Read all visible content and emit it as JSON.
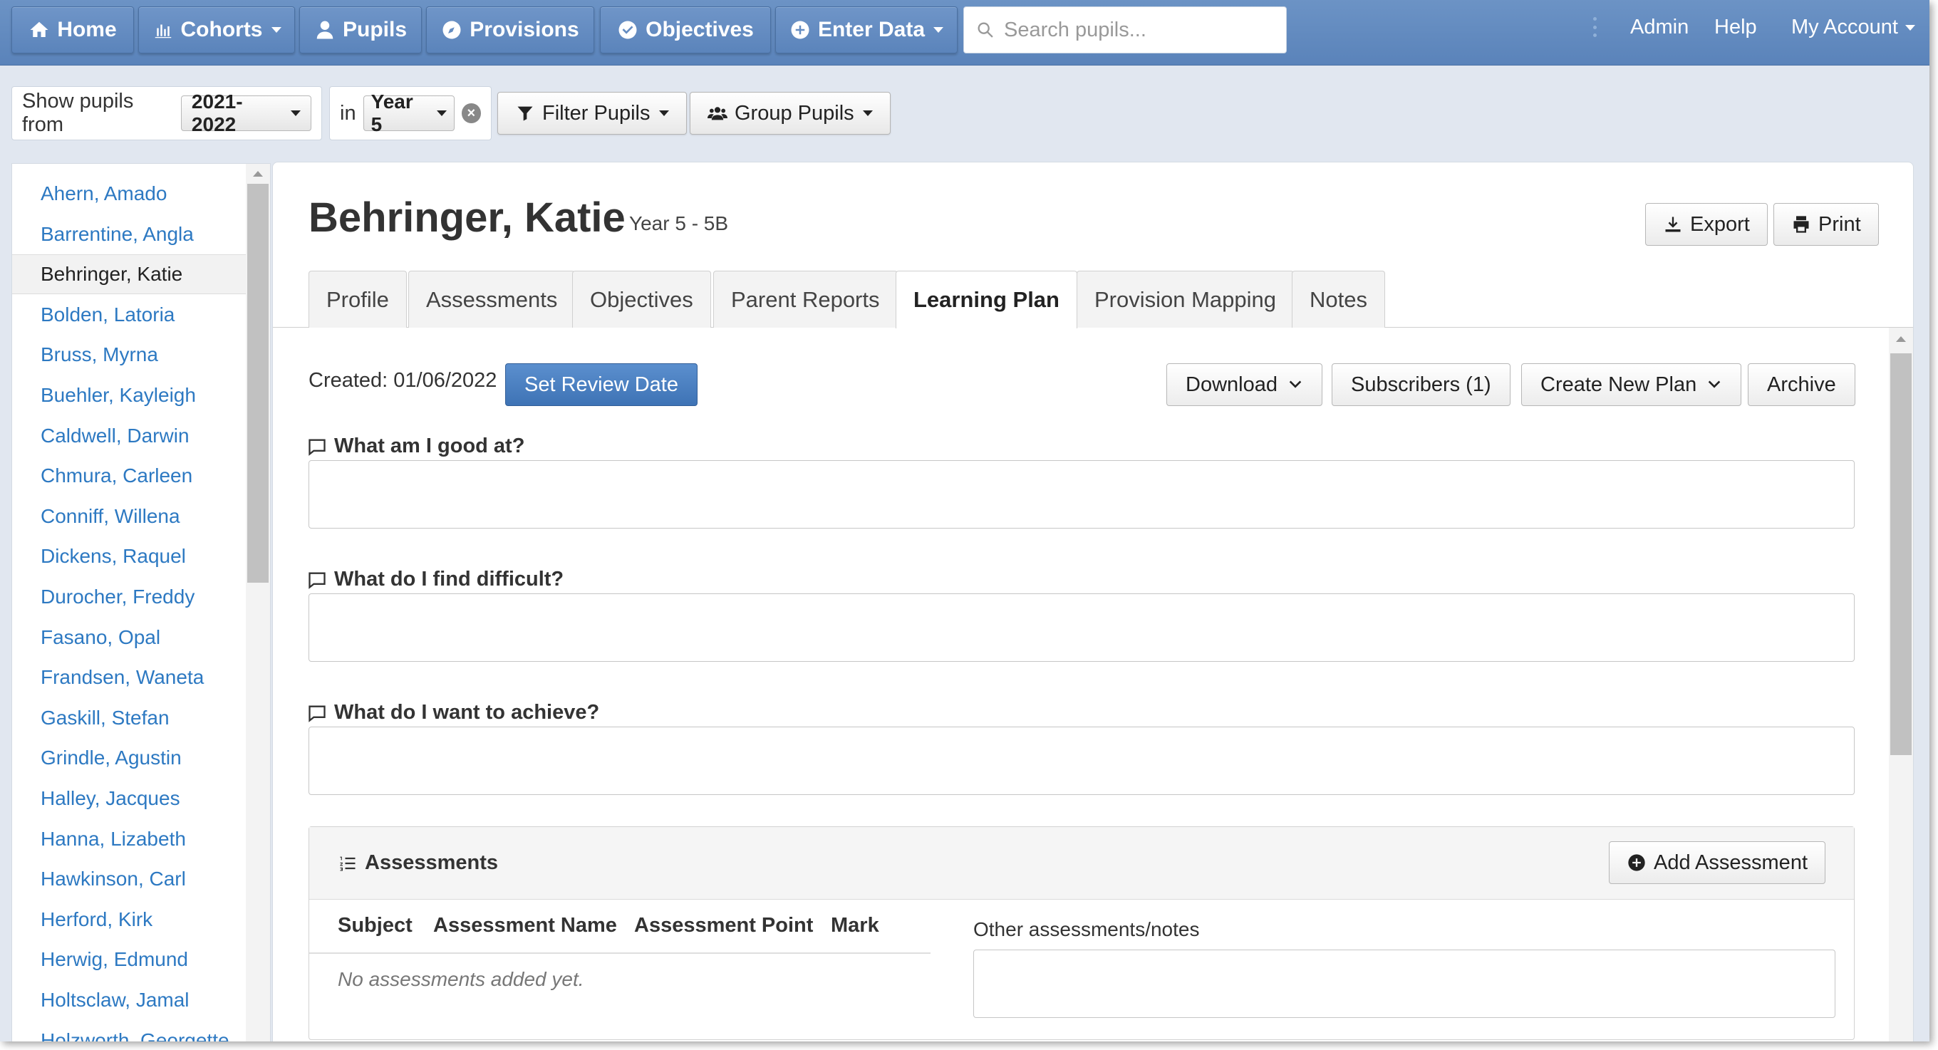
{
  "nav": {
    "home": "Home",
    "cohorts": "Cohorts",
    "pupils": "Pupils",
    "provisions": "Provisions",
    "objectives": "Objectives",
    "enter_data": "Enter Data",
    "search_placeholder": "Search pupils...",
    "admin": "Admin",
    "help": "Help",
    "my_account": "My Account"
  },
  "filters": {
    "show_pupils_from": "Show pupils from",
    "year_range": "2021-2022",
    "in": "in",
    "year_group": "Year 5",
    "filter_pupils": "Filter Pupils",
    "group_pupils": "Group Pupils"
  },
  "sidebar": {
    "pupils": [
      "Ahern, Amado",
      "Barrentine, Angla",
      "Behringer, Katie",
      "Bolden, Latoria",
      "Bruss, Myrna",
      "Buehler, Kayleigh",
      "Caldwell, Darwin",
      "Chmura, Carleen",
      "Conniff, Willena",
      "Dickens, Raquel",
      "Durocher, Freddy",
      "Fasano, Opal",
      "Frandsen, Waneta",
      "Gaskill, Stefan",
      "Grindle, Agustin",
      "Halley, Jacques",
      "Hanna, Lizabeth",
      "Hawkinson, Carl",
      "Herford, Kirk",
      "Herwig, Edmund",
      "Holtsclaw, Jamal",
      "Holzworth, Georgette"
    ],
    "active_pupil": "Behringer, Katie"
  },
  "pupil": {
    "name": "Behringer, Katie",
    "class": "Year 5 - 5B",
    "export": "Export",
    "print": "Print"
  },
  "tabs": [
    "Profile",
    "Assessments",
    "Objectives",
    "Parent Reports",
    "Learning Plan",
    "Provision Mapping",
    "Notes"
  ],
  "active_tab": "Learning Plan",
  "plan": {
    "created": "Created: 01/06/2022",
    "set_review_date": "Set Review Date",
    "download": "Download",
    "subscribers": "Subscribers (1)",
    "create_new_plan": "Create New Plan",
    "archive": "Archive",
    "q1": "What am I good at?",
    "q2": "What do I find difficult?",
    "q3": "What do I want to achieve?"
  },
  "assessments": {
    "title": "Assessments",
    "add": "Add Assessment",
    "col_subject": "Subject",
    "col_name": "Assessment Name",
    "col_point": "Assessment Point",
    "col_mark": "Mark",
    "empty": "No assessments added yet.",
    "other_label": "Other assessments/notes"
  },
  "colors": {
    "nav_blue": "#5a83ba",
    "link_blue": "#2d79c2",
    "primary_button": "#3e73b5",
    "page_bg": "#e1e7f0"
  }
}
